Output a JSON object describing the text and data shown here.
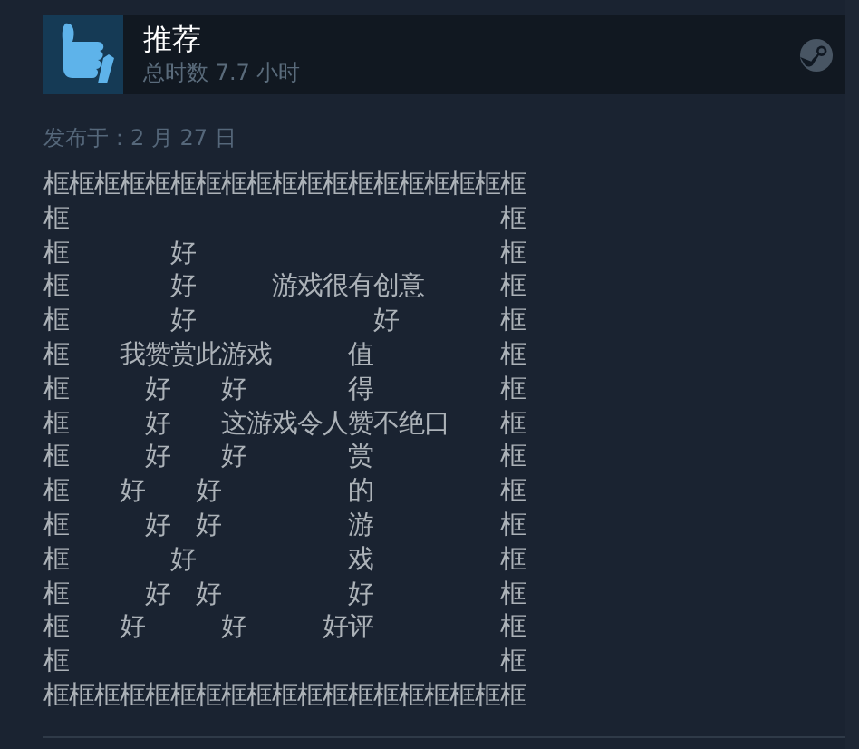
{
  "review": {
    "verdict": "推荐",
    "recommended": true,
    "playtime": "总时数 7.7 小时",
    "posted": "发布于：2 月 27 日",
    "lines": [
      "框框框框框框框框框框框框框框框框框框框",
      "框　　　　　　　　　　　　　　　　　框",
      "框　　　　好　　　　　　　　　　　　框",
      "框　　　　好　　　游戏很有创意　　　框",
      "框　　　　好　　　　　　　好　　　　框",
      "框　　我赞赏此游戏　　　值　　　　　框",
      "框　　　好　　好　　　　得　　　　　框",
      "框　　　好　　这游戏令人赞不绝口　　框",
      "框　　　好　　好　　　　赏　　　　　框",
      "框　　好　　好　　　　　的　　　　　框",
      "框　　　好　好　　　　　游　　　　　框",
      "框　　　　好　　　　　　戏　　　　　框",
      "框　　　好　好　　　　　好　　　　　框",
      "框　　好　　　好　　　好评　　　　　框",
      "框　　　　　　　　　　　　　　　　　框",
      "框框框框框框框框框框框框框框框框框框框"
    ]
  }
}
